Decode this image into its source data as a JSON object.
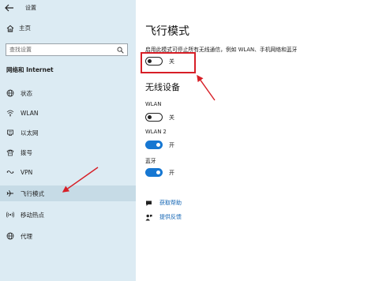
{
  "window": {
    "title": "设置"
  },
  "sidebar": {
    "home_label": "主页",
    "search_placeholder": "查找设置",
    "section_label": "网络和 Internet",
    "items": [
      {
        "label": "状态",
        "icon": "globe-icon"
      },
      {
        "label": "WLAN",
        "icon": "wifi-icon"
      },
      {
        "label": "以太网",
        "icon": "ethernet-icon"
      },
      {
        "label": "拨号",
        "icon": "dialup-icon"
      },
      {
        "label": "VPN",
        "icon": "vpn-icon"
      },
      {
        "label": "飞行模式",
        "icon": "airplane-icon",
        "selected": true
      },
      {
        "label": "移动热点",
        "icon": "hotspot-icon"
      },
      {
        "label": "代理",
        "icon": "globe-icon"
      }
    ]
  },
  "main": {
    "title": "飞行模式",
    "description": "启用此模式可停止所有无线通信，例如 WLAN、手机网络和蓝牙",
    "airplane_toggle": {
      "state_label": "关",
      "on": false
    },
    "wireless_title": "无线设备",
    "devices": [
      {
        "label": "WLAN",
        "state_label": "关",
        "on": false
      },
      {
        "label": "WLAN 2",
        "state_label": "开",
        "on": true
      },
      {
        "label": "蓝牙",
        "state_label": "开",
        "on": true
      }
    ],
    "links": [
      {
        "label": "获取帮助",
        "icon": "help-chat-icon"
      },
      {
        "label": "提供反馈",
        "icon": "feedback-icon"
      }
    ]
  },
  "colors": {
    "sidebar_bg": "#dcebf3",
    "accent": "#1677d2",
    "annotation_red": "#d71f27"
  }
}
